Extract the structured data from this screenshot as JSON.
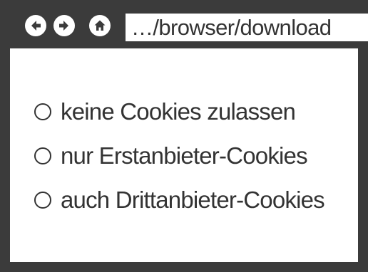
{
  "browser": {
    "address": "…/browser/download",
    "nav": {
      "back_icon": "back-arrow-icon",
      "forward_icon": "forward-arrow-icon",
      "home_icon": "home-icon"
    },
    "colors": {
      "frame": "#3b3b3b",
      "text": "#333333",
      "background": "#ffffff"
    }
  },
  "cookie_options": [
    {
      "label": "keine Cookies zulassen",
      "selected": false
    },
    {
      "label": "nur Erstanbieter-Cookies",
      "selected": false
    },
    {
      "label": "auch Drittanbieter-Cookies",
      "selected": false
    }
  ]
}
